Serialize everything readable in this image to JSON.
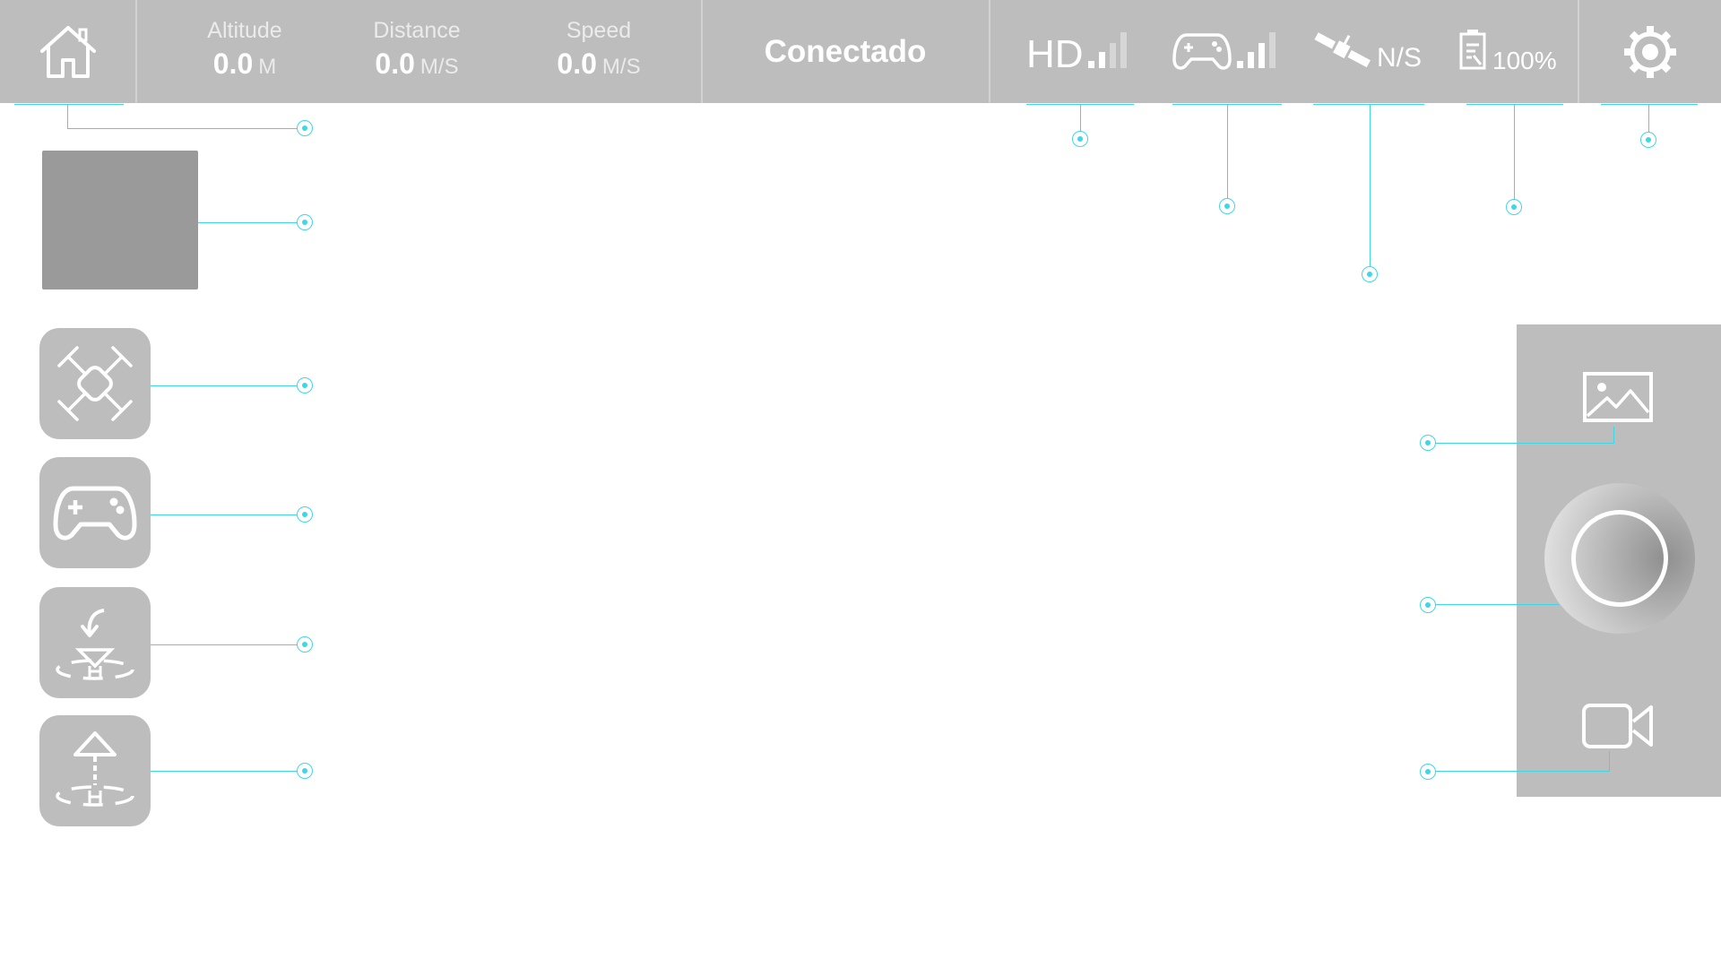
{
  "topbar": {
    "altitude": {
      "label": "Altitude",
      "value": "0.0",
      "unit": "M"
    },
    "distance": {
      "label": "Distance",
      "value": "0.0",
      "unit": "M/S"
    },
    "speed": {
      "label": "Speed",
      "value": "0.0",
      "unit": "M/S"
    },
    "connection_status": "Conectado",
    "hd_label": "HD",
    "gps_status": "N/S",
    "battery": "100%",
    "signal_levels": {
      "hd": 2,
      "controller": 2
    }
  },
  "icons": {
    "home": "home-icon",
    "settings": "gear-icon",
    "satellite": "satellite-icon",
    "battery": "battery-icon",
    "controller": "gamepad-icon",
    "drone": "drone-icon",
    "return_home": "return-home-icon",
    "takeoff": "takeoff-icon",
    "gallery": "gallery-icon",
    "shutter": "shutter-icon",
    "video": "video-camera-icon"
  },
  "colors": {
    "bar_background": "#bdbdbd",
    "accent_callout": "#3fd6e6",
    "thumbnail": "#9a9a9a"
  }
}
